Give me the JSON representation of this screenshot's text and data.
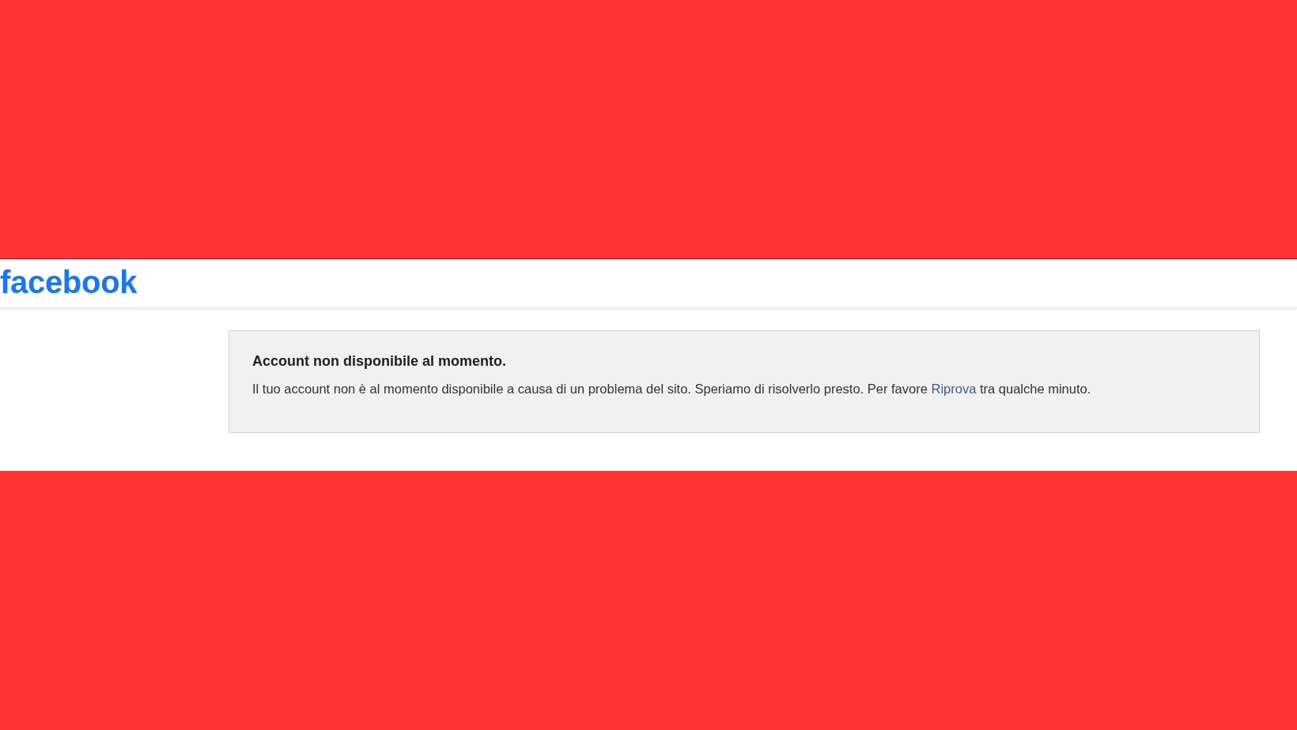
{
  "header": {
    "logo": "facebook"
  },
  "notice": {
    "title": "Account non disponibile al momento.",
    "message": {
      "before": "Il tuo account non è al momento disponibile a causa di un problema del sito. Speriamo di risolverlo presto. Per favore",
      "link": "Riprova",
      "after": "tra qualche minuto."
    }
  }
}
